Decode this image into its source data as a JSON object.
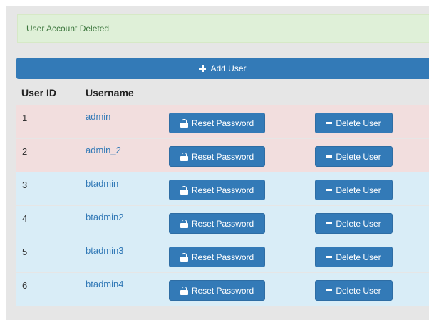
{
  "alert": {
    "message": "User Account Deleted"
  },
  "toolbar": {
    "add_user_label": "Add User"
  },
  "table": {
    "headers": {
      "user_id": "User ID",
      "username": "Username"
    },
    "reset_label": "Reset Password",
    "delete_label": "Delete User",
    "rows": [
      {
        "id": "1",
        "username": "admin",
        "state": "danger"
      },
      {
        "id": "2",
        "username": "admin_2",
        "state": "danger"
      },
      {
        "id": "3",
        "username": "btadmin",
        "state": "info"
      },
      {
        "id": "4",
        "username": "btadmin2",
        "state": "info"
      },
      {
        "id": "5",
        "username": "btadmin3",
        "state": "info"
      },
      {
        "id": "6",
        "username": "btadmin4",
        "state": "info"
      }
    ]
  },
  "colors": {
    "primary": "#337ab7",
    "danger_row": "#f2dede",
    "info_row": "#d9edf7",
    "success_bg": "#dff0d8",
    "success_text": "#3c763d"
  }
}
